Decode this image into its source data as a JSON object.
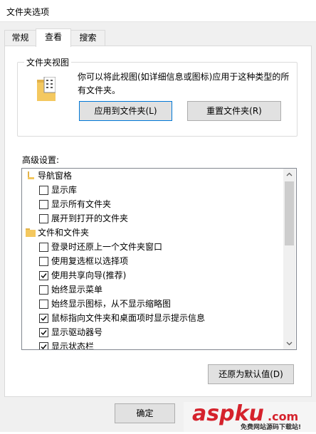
{
  "window": {
    "title": "文件夹选项"
  },
  "tabs": [
    {
      "label": "常规"
    },
    {
      "label": "查看"
    },
    {
      "label": "搜索"
    }
  ],
  "folder_views": {
    "title": "文件夹视图",
    "description": "你可以将此视图(如详细信息或图标)应用于这种类型的所有文件夹。",
    "apply_button": "应用到文件夹(L)",
    "reset_button": "重置文件夹(R)"
  },
  "advanced": {
    "label": "高级设置:",
    "items": [
      {
        "text": "导航窗格",
        "kind": "category",
        "icon": "navigation-pane-icon"
      },
      {
        "text": "显示库",
        "kind": "checkbox",
        "checked": false
      },
      {
        "text": "显示所有文件夹",
        "kind": "checkbox",
        "checked": false
      },
      {
        "text": "展开到打开的文件夹",
        "kind": "checkbox",
        "checked": false
      },
      {
        "text": "文件和文件夹",
        "kind": "category",
        "icon": "folder-icon"
      },
      {
        "text": "登录时还原上一个文件夹窗口",
        "kind": "checkbox",
        "checked": false
      },
      {
        "text": "使用复选框以选择项",
        "kind": "checkbox",
        "checked": false
      },
      {
        "text": "使用共享向导(推荐)",
        "kind": "checkbox",
        "checked": true
      },
      {
        "text": "始终显示菜单",
        "kind": "checkbox",
        "checked": false
      },
      {
        "text": "始终显示图标，从不显示缩略图",
        "kind": "checkbox",
        "checked": false
      },
      {
        "text": "鼠标指向文件夹和桌面项时显示提示信息",
        "kind": "checkbox",
        "checked": true
      },
      {
        "text": "显示驱动器号",
        "kind": "checkbox",
        "checked": true
      },
      {
        "text": "显示状态栏",
        "kind": "checkbox",
        "checked": true
      }
    ]
  },
  "buttons": {
    "restore_defaults": "还原为默认值(D)",
    "ok": "确定"
  },
  "watermark": {
    "brand": "aspku",
    "tagline": "免费网站源码下载站!"
  },
  "colors": {
    "accent": "#0078d7",
    "folder_yellow": "#f4c85f",
    "watermark_red": "#d5222c"
  }
}
